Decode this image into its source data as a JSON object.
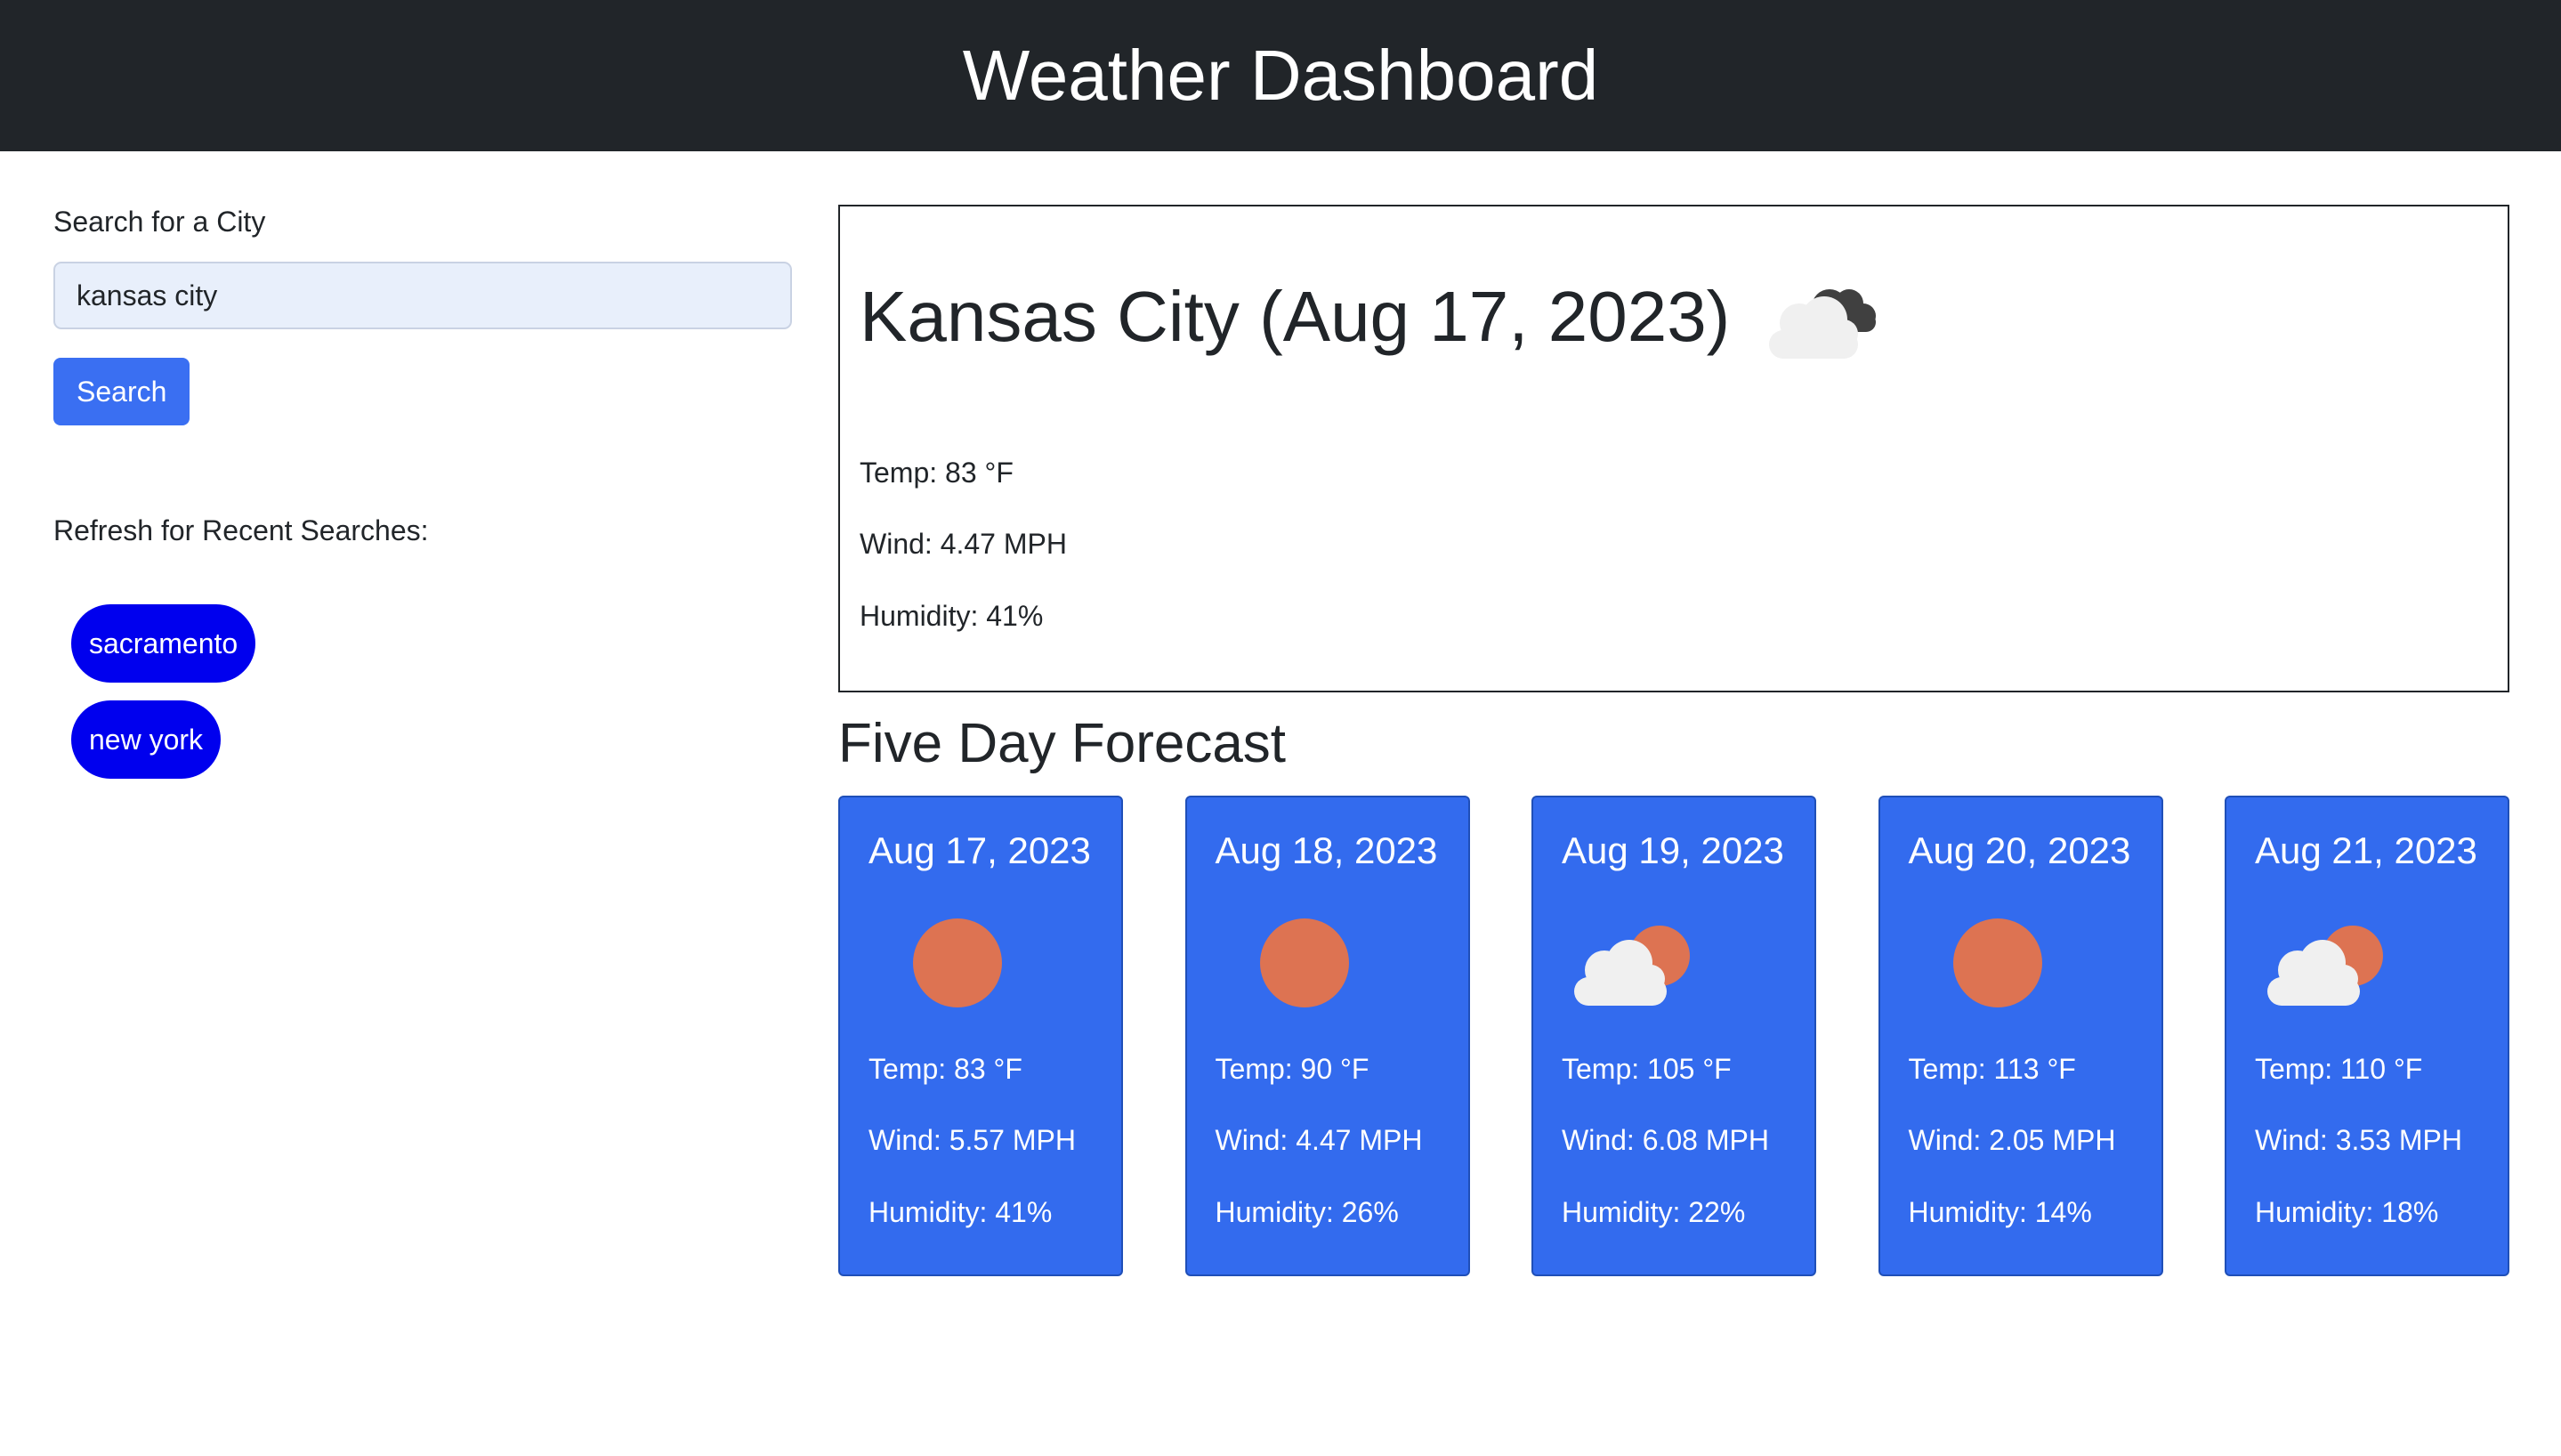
{
  "header": {
    "title": "Weather Dashboard"
  },
  "search": {
    "label": "Search for a City",
    "value": "kansas city",
    "placeholder": "",
    "button_label": "Search"
  },
  "recent": {
    "label": "Refresh for Recent Searches:",
    "items": [
      "sacramento",
      "new york"
    ]
  },
  "current": {
    "heading": "Kansas City (Aug 17, 2023)",
    "icon": "broken-clouds-icon",
    "temp": "Temp: 83 °F",
    "wind": "Wind: 4.47 MPH",
    "humidity": "Humidity: 41%"
  },
  "forecast": {
    "title": "Five Day Forecast",
    "days": [
      {
        "date": "Aug 17, 2023",
        "icon": "clear-sky-icon",
        "temp": "Temp: 83 °F",
        "wind": "Wind: 5.57 MPH",
        "humidity": "Humidity: 41%"
      },
      {
        "date": "Aug 18, 2023",
        "icon": "clear-sky-icon",
        "temp": "Temp: 90 °F",
        "wind": "Wind: 4.47 MPH",
        "humidity": "Humidity: 26%"
      },
      {
        "date": "Aug 19, 2023",
        "icon": "few-clouds-icon",
        "temp": "Temp: 105 °F",
        "wind": "Wind: 6.08 MPH",
        "humidity": "Humidity: 22%"
      },
      {
        "date": "Aug 20, 2023",
        "icon": "clear-sky-icon",
        "temp": "Temp: 113 °F",
        "wind": "Wind: 2.05 MPH",
        "humidity": "Humidity: 14%"
      },
      {
        "date": "Aug 21, 2023",
        "icon": "few-clouds-icon",
        "temp": "Temp: 110 °F",
        "wind": "Wind: 3.53 MPH",
        "humidity": "Humidity: 18%"
      }
    ]
  },
  "colors": {
    "header_bg": "#212529",
    "button_blue": "#3a6ff2",
    "pill_blue": "#0000ee",
    "card_blue": "#336bee",
    "sun": "#dd7352",
    "cloud": "#f0f0f0",
    "dark_cloud": "#404040"
  }
}
